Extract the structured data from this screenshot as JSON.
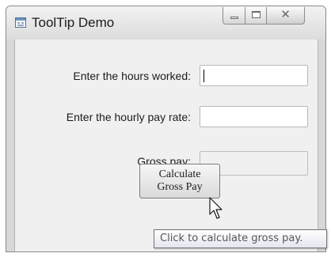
{
  "window": {
    "title": "ToolTip Demo",
    "app_icon": "form-window-icon",
    "controls": {
      "minimize_icon": "minimize-icon",
      "maximize_icon": "maximize-icon",
      "close_icon": "close-icon",
      "close_glyph": "✕"
    }
  },
  "form": {
    "hours_label": "Enter the hours worked:",
    "hours_value": "",
    "rate_label": "Enter the hourly pay rate:",
    "rate_value": "",
    "gross_label": "Gross pay:",
    "gross_value": ""
  },
  "calculate_button": {
    "line1": "Calculate",
    "line2": "Gross Pay"
  },
  "tooltip": {
    "text": "Click to calculate gross pay."
  },
  "pointer_icon": "mouse-pointer-icon",
  "colors": {
    "window_chrome": "#d8d8d8",
    "client_area": "#f0f0f0",
    "tooltip_text": "#575757"
  }
}
